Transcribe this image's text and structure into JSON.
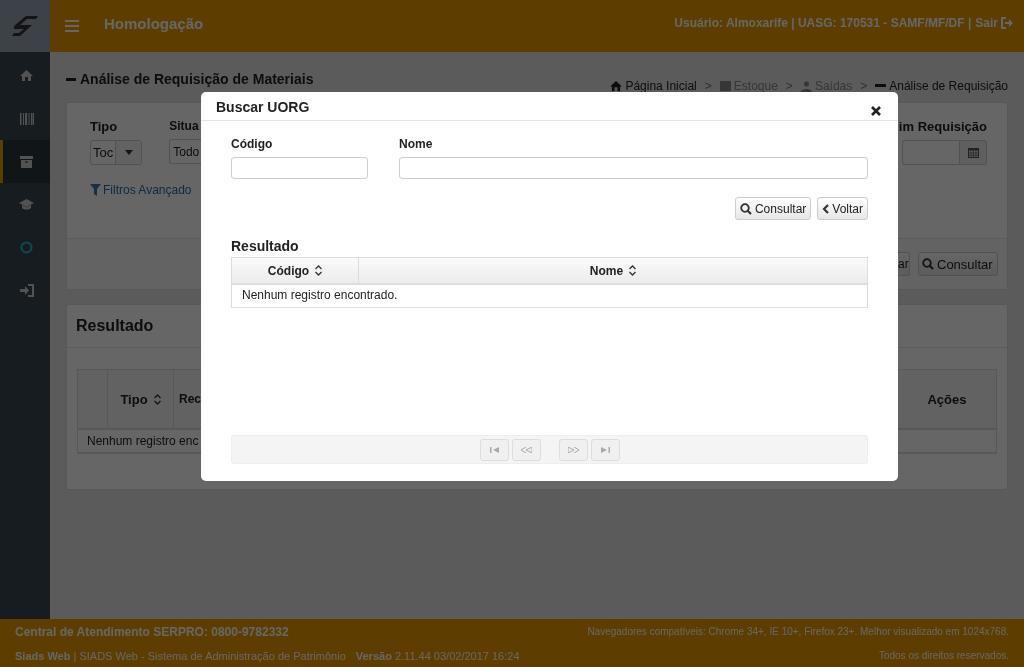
{
  "header": {
    "title": "Homologação",
    "user_info": "Usuário: Almoxarife | UASG: 170531 - SAMF/MF/DF |",
    "logout": "Sair"
  },
  "sidebar": {
    "items": [
      {
        "selected": false
      },
      {
        "selected": false
      },
      {
        "selected": true
      },
      {
        "selected": false
      },
      {
        "selected": false
      },
      {
        "selected": false
      }
    ]
  },
  "page": {
    "title": "Análise de Requisição de Materiais",
    "separator": ">",
    "breadcrumb": [
      {
        "label": "Página Inicial",
        "kind": "home",
        "disabled": false
      },
      {
        "label": "Estoque",
        "kind": "box",
        "disabled": true
      },
      {
        "label": "Saídas",
        "kind": "user",
        "disabled": true
      },
      {
        "label": "Análise de Requisição",
        "kind": "current",
        "disabled": false
      }
    ]
  },
  "filters": {
    "fields": [
      {
        "label": "Tipo",
        "value": "Toc",
        "kind": "select"
      },
      {
        "label": "Situa",
        "value": "Todo",
        "kind": "text"
      }
    ],
    "advanced_link": "Filtros Avançado",
    "end_field": {
      "label": "im Requisição"
    },
    "buttons": [
      {
        "label": "ar",
        "kind": "plain"
      },
      {
        "label": "Consultar",
        "kind": "search"
      }
    ]
  },
  "results": {
    "title": "Resultado",
    "columns": [
      {
        "label": "Tipo",
        "sortable": true
      },
      {
        "label": "Rec"
      },
      {
        "label": "Ações",
        "sortable": false
      }
    ],
    "empty_message": "Nenhum registro enc"
  },
  "modal": {
    "title": "Buscar UORG",
    "fields": [
      {
        "label": "Código"
      },
      {
        "label": "Nome"
      }
    ],
    "buttons": [
      {
        "label": "Consultar",
        "kind": "search"
      },
      {
        "label": "Voltar",
        "kind": "back"
      }
    ],
    "result_title": "Resultado",
    "columns": [
      {
        "label": "Código",
        "sortable": true
      },
      {
        "label": "Nome",
        "sortable": true
      }
    ],
    "empty_message": "Nenhum registro encontrado.",
    "pager": [
      {
        "kind": "first",
        "disabled": true
      },
      {
        "kind": "prev",
        "disabled": true
      },
      {
        "kind": "next",
        "disabled": true
      },
      {
        "kind": "last",
        "disabled": true
      }
    ]
  },
  "footer": {
    "support": "Central de Atendimento SERPRO: 0800-9782332",
    "browsers": "Navegadores compatíveis: Chrome 34+, IE 10+, Firefox 23+. Melhor visualizado em 1024x768.",
    "system": "**Siads Web** | SIADS Web - Sistema de Administração de Patrimônio",
    "version": "**Versão** 2.11.44 03/02/2017 16:24",
    "rights": "Todos os direitos reservados."
  }
}
